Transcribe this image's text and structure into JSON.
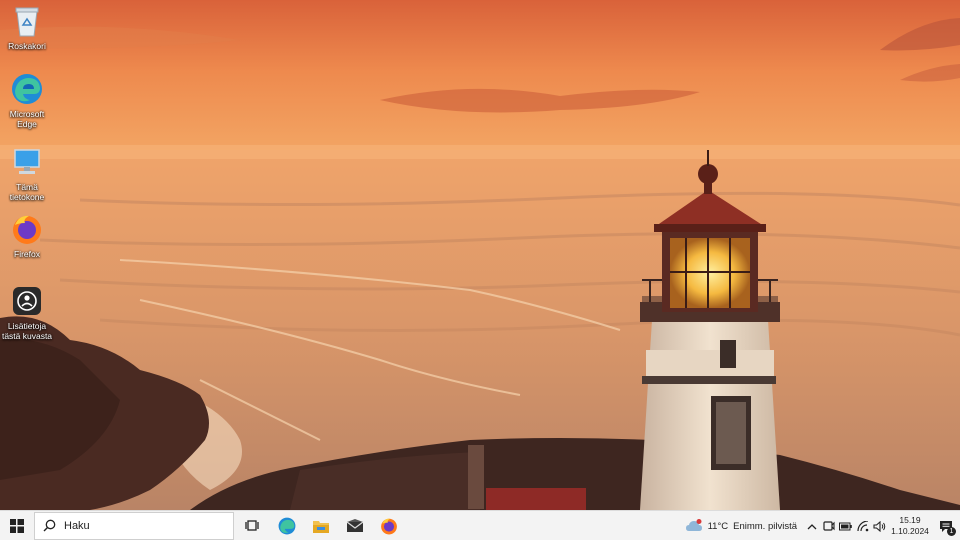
{
  "desktop": {
    "icons": [
      {
        "name": "recycle-bin",
        "label": "Roskakori",
        "icon": "recycle-bin-icon"
      },
      {
        "name": "microsoft-edge",
        "label": "Microsoft\nEdge",
        "icon": "edge-icon"
      },
      {
        "name": "this-pc",
        "label": "Tämä\ntietokone",
        "icon": "computer-icon"
      },
      {
        "name": "firefox",
        "label": "Firefox",
        "icon": "firefox-icon"
      },
      {
        "name": "learn-about-picture",
        "label": "Lisätietoja\ntästä kuvasta",
        "icon": "camera-info-icon"
      }
    ]
  },
  "taskbar": {
    "search": {
      "placeholder": "Haku"
    },
    "pinned": [
      "task-view-icon",
      "edge-icon",
      "file-explorer-icon",
      "mail-icon",
      "firefox-icon"
    ],
    "weather": {
      "temperature": "11°C",
      "condition": "Enimm. pilvistä"
    },
    "clock": {
      "time": "15.19",
      "date": "1.10.2024"
    },
    "notifications": {
      "count": "1"
    }
  },
  "colors": {
    "sky_top": "#e0703c",
    "sea": "#e6a070",
    "taskbar": "#f3f3f3",
    "accent": "#0078d4"
  }
}
